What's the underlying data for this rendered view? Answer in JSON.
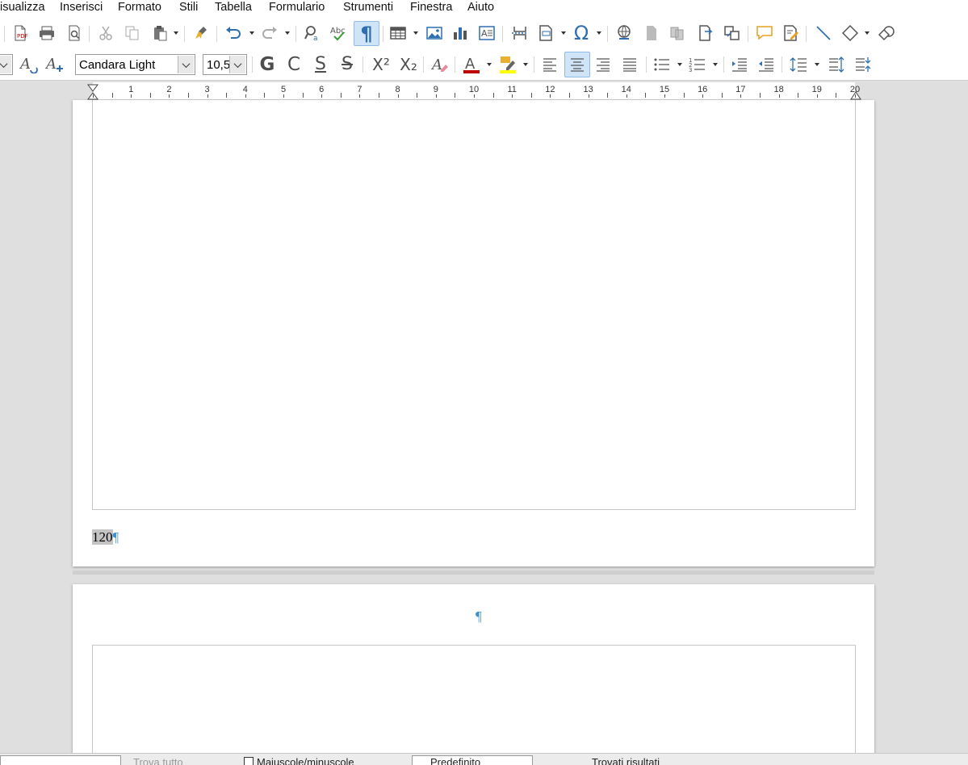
{
  "menu": {
    "items": [
      "isualizza",
      "Inserisci",
      "Formato",
      "Stili",
      "Tabella",
      "Formulario",
      "Strumenti",
      "Finestra",
      "Aiuto"
    ]
  },
  "formatting": {
    "font_name": "Candara Light",
    "font_size": "10,5"
  },
  "toolbar_icons": {
    "bold": "G",
    "italic": "C",
    "underline": "S",
    "strikethrough": "S",
    "superscript": "X²",
    "subscript": "X₂",
    "special_character": "Ω",
    "formatting_marks": "¶",
    "font_color": "#c00000",
    "highlight_color": "#ffff00"
  },
  "ruler": {
    "labels": [
      "1",
      "2",
      "3",
      "4",
      "5",
      "6",
      "7",
      "8",
      "9",
      "10",
      "11",
      "12",
      "13",
      "14",
      "15",
      "16",
      "17",
      "18",
      "19",
      "20"
    ]
  },
  "document": {
    "page_number_text": "120",
    "pilcrow": "¶"
  },
  "statusbar": {
    "case_label": "Maiuscole/minuscole",
    "page_style_label": "Predefinito",
    "left_text": "Trova tutto",
    "right_text": "Trovati risultati"
  }
}
